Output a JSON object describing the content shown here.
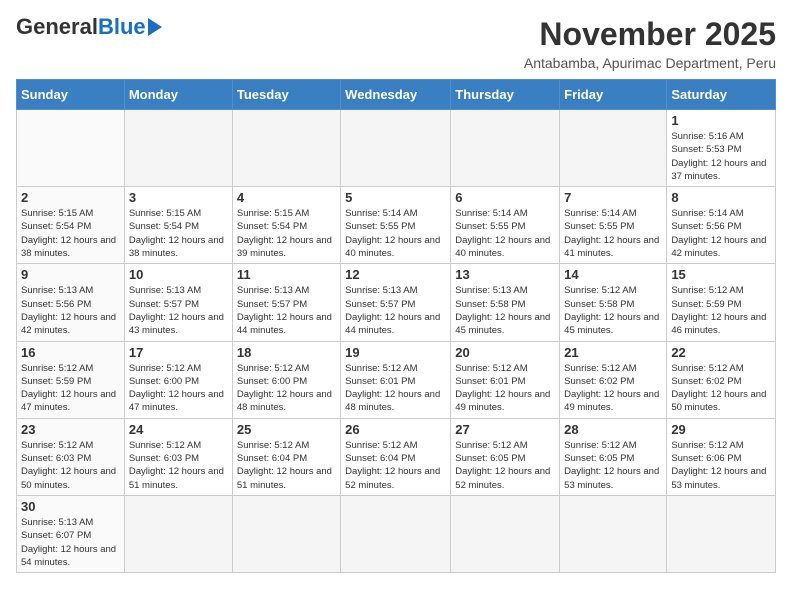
{
  "header": {
    "logo_general": "General",
    "logo_blue": "Blue",
    "month_title": "November 2025",
    "subtitle": "Antabamba, Apurimac Department, Peru"
  },
  "weekdays": [
    "Sunday",
    "Monday",
    "Tuesday",
    "Wednesday",
    "Thursday",
    "Friday",
    "Saturday"
  ],
  "weeks": [
    [
      {
        "day": "",
        "info": ""
      },
      {
        "day": "",
        "info": ""
      },
      {
        "day": "",
        "info": ""
      },
      {
        "day": "",
        "info": ""
      },
      {
        "day": "",
        "info": ""
      },
      {
        "day": "",
        "info": ""
      },
      {
        "day": "1",
        "info": "Sunrise: 5:16 AM\nSunset: 5:53 PM\nDaylight: 12 hours and 37 minutes."
      }
    ],
    [
      {
        "day": "2",
        "info": "Sunrise: 5:15 AM\nSunset: 5:54 PM\nDaylight: 12 hours and 38 minutes."
      },
      {
        "day": "3",
        "info": "Sunrise: 5:15 AM\nSunset: 5:54 PM\nDaylight: 12 hours and 38 minutes."
      },
      {
        "day": "4",
        "info": "Sunrise: 5:15 AM\nSunset: 5:54 PM\nDaylight: 12 hours and 39 minutes."
      },
      {
        "day": "5",
        "info": "Sunrise: 5:14 AM\nSunset: 5:55 PM\nDaylight: 12 hours and 40 minutes."
      },
      {
        "day": "6",
        "info": "Sunrise: 5:14 AM\nSunset: 5:55 PM\nDaylight: 12 hours and 40 minutes."
      },
      {
        "day": "7",
        "info": "Sunrise: 5:14 AM\nSunset: 5:55 PM\nDaylight: 12 hours and 41 minutes."
      },
      {
        "day": "8",
        "info": "Sunrise: 5:14 AM\nSunset: 5:56 PM\nDaylight: 12 hours and 42 minutes."
      }
    ],
    [
      {
        "day": "9",
        "info": "Sunrise: 5:13 AM\nSunset: 5:56 PM\nDaylight: 12 hours and 42 minutes."
      },
      {
        "day": "10",
        "info": "Sunrise: 5:13 AM\nSunset: 5:57 PM\nDaylight: 12 hours and 43 minutes."
      },
      {
        "day": "11",
        "info": "Sunrise: 5:13 AM\nSunset: 5:57 PM\nDaylight: 12 hours and 44 minutes."
      },
      {
        "day": "12",
        "info": "Sunrise: 5:13 AM\nSunset: 5:57 PM\nDaylight: 12 hours and 44 minutes."
      },
      {
        "day": "13",
        "info": "Sunrise: 5:13 AM\nSunset: 5:58 PM\nDaylight: 12 hours and 45 minutes."
      },
      {
        "day": "14",
        "info": "Sunrise: 5:12 AM\nSunset: 5:58 PM\nDaylight: 12 hours and 45 minutes."
      },
      {
        "day": "15",
        "info": "Sunrise: 5:12 AM\nSunset: 5:59 PM\nDaylight: 12 hours and 46 minutes."
      }
    ],
    [
      {
        "day": "16",
        "info": "Sunrise: 5:12 AM\nSunset: 5:59 PM\nDaylight: 12 hours and 47 minutes."
      },
      {
        "day": "17",
        "info": "Sunrise: 5:12 AM\nSunset: 6:00 PM\nDaylight: 12 hours and 47 minutes."
      },
      {
        "day": "18",
        "info": "Sunrise: 5:12 AM\nSunset: 6:00 PM\nDaylight: 12 hours and 48 minutes."
      },
      {
        "day": "19",
        "info": "Sunrise: 5:12 AM\nSunset: 6:01 PM\nDaylight: 12 hours and 48 minutes."
      },
      {
        "day": "20",
        "info": "Sunrise: 5:12 AM\nSunset: 6:01 PM\nDaylight: 12 hours and 49 minutes."
      },
      {
        "day": "21",
        "info": "Sunrise: 5:12 AM\nSunset: 6:02 PM\nDaylight: 12 hours and 49 minutes."
      },
      {
        "day": "22",
        "info": "Sunrise: 5:12 AM\nSunset: 6:02 PM\nDaylight: 12 hours and 50 minutes."
      }
    ],
    [
      {
        "day": "23",
        "info": "Sunrise: 5:12 AM\nSunset: 6:03 PM\nDaylight: 12 hours and 50 minutes."
      },
      {
        "day": "24",
        "info": "Sunrise: 5:12 AM\nSunset: 6:03 PM\nDaylight: 12 hours and 51 minutes."
      },
      {
        "day": "25",
        "info": "Sunrise: 5:12 AM\nSunset: 6:04 PM\nDaylight: 12 hours and 51 minutes."
      },
      {
        "day": "26",
        "info": "Sunrise: 5:12 AM\nSunset: 6:04 PM\nDaylight: 12 hours and 52 minutes."
      },
      {
        "day": "27",
        "info": "Sunrise: 5:12 AM\nSunset: 6:05 PM\nDaylight: 12 hours and 52 minutes."
      },
      {
        "day": "28",
        "info": "Sunrise: 5:12 AM\nSunset: 6:05 PM\nDaylight: 12 hours and 53 minutes."
      },
      {
        "day": "29",
        "info": "Sunrise: 5:12 AM\nSunset: 6:06 PM\nDaylight: 12 hours and 53 minutes."
      }
    ],
    [
      {
        "day": "30",
        "info": "Sunrise: 5:13 AM\nSunset: 6:07 PM\nDaylight: 12 hours and 54 minutes."
      },
      {
        "day": "",
        "info": ""
      },
      {
        "day": "",
        "info": ""
      },
      {
        "day": "",
        "info": ""
      },
      {
        "day": "",
        "info": ""
      },
      {
        "day": "",
        "info": ""
      },
      {
        "day": "",
        "info": ""
      }
    ]
  ]
}
